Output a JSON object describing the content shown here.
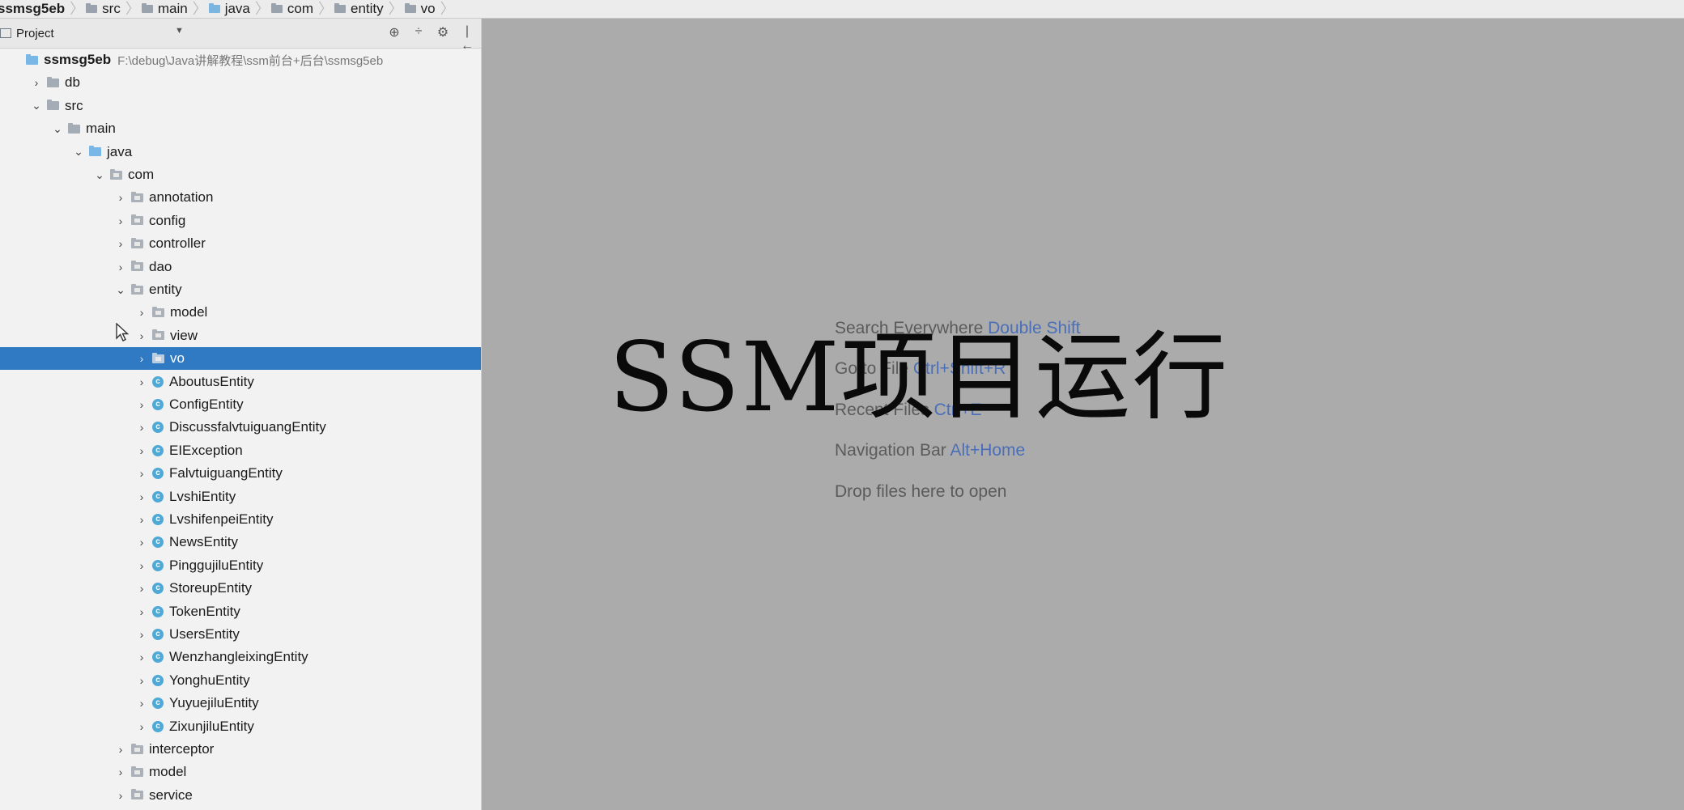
{
  "breadcrumb": [
    {
      "label": "ssmsg5eb",
      "icon": "module-folder-icon"
    },
    {
      "label": "src",
      "icon": "folder-icon"
    },
    {
      "label": "main",
      "icon": "folder-icon"
    },
    {
      "label": "java",
      "icon": "source-folder-icon"
    },
    {
      "label": "com",
      "icon": "package-icon"
    },
    {
      "label": "entity",
      "icon": "package-icon"
    },
    {
      "label": "vo",
      "icon": "package-icon"
    }
  ],
  "panel": {
    "title": "Project",
    "tools": [
      "⊕",
      "÷",
      "⚙",
      "|←"
    ]
  },
  "tree": [
    {
      "label": "ssmsg5eb",
      "note": "F:\\debug\\Java讲解教程\\ssm前台+后台\\ssmsg5eb",
      "depth": 0,
      "arrow": "",
      "icon": "module",
      "bold": true
    },
    {
      "label": "db",
      "depth": 1,
      "arrow": ">",
      "icon": "folder"
    },
    {
      "label": "src",
      "depth": 1,
      "arrow": "v",
      "icon": "folder"
    },
    {
      "label": "main",
      "depth": 2,
      "arrow": "v",
      "icon": "folder"
    },
    {
      "label": "java",
      "depth": 3,
      "arrow": "v",
      "icon": "src"
    },
    {
      "label": "com",
      "depth": 4,
      "arrow": "v",
      "icon": "pkg"
    },
    {
      "label": "annotation",
      "depth": 5,
      "arrow": ">",
      "icon": "pkg"
    },
    {
      "label": "config",
      "depth": 5,
      "arrow": ">",
      "icon": "pkg"
    },
    {
      "label": "controller",
      "depth": 5,
      "arrow": ">",
      "icon": "pkg"
    },
    {
      "label": "dao",
      "depth": 5,
      "arrow": ">",
      "icon": "pkg"
    },
    {
      "label": "entity",
      "depth": 5,
      "arrow": "v",
      "icon": "pkg"
    },
    {
      "label": "model",
      "depth": 6,
      "arrow": ">",
      "icon": "pkg"
    },
    {
      "label": "view",
      "depth": 6,
      "arrow": ">",
      "icon": "pkg"
    },
    {
      "label": "vo",
      "depth": 6,
      "arrow": ">",
      "icon": "pkg",
      "selected": true
    },
    {
      "label": "AboutusEntity",
      "depth": 6,
      "arrow": ">",
      "icon": "class"
    },
    {
      "label": "ConfigEntity",
      "depth": 6,
      "arrow": ">",
      "icon": "class"
    },
    {
      "label": "DiscussfalvtuiguangEntity",
      "depth": 6,
      "arrow": ">",
      "icon": "class"
    },
    {
      "label": "EIException",
      "depth": 6,
      "arrow": ">",
      "icon": "class"
    },
    {
      "label": "FalvtuiguangEntity",
      "depth": 6,
      "arrow": ">",
      "icon": "class"
    },
    {
      "label": "LvshiEntity",
      "depth": 6,
      "arrow": ">",
      "icon": "class"
    },
    {
      "label": "LvshifenpeiEntity",
      "depth": 6,
      "arrow": ">",
      "icon": "class"
    },
    {
      "label": "NewsEntity",
      "depth": 6,
      "arrow": ">",
      "icon": "class"
    },
    {
      "label": "PinggujiluEntity",
      "depth": 6,
      "arrow": ">",
      "icon": "class"
    },
    {
      "label": "StoreupEntity",
      "depth": 6,
      "arrow": ">",
      "icon": "class"
    },
    {
      "label": "TokenEntity",
      "depth": 6,
      "arrow": ">",
      "icon": "class"
    },
    {
      "label": "UsersEntity",
      "depth": 6,
      "arrow": ">",
      "icon": "class"
    },
    {
      "label": "WenzhangleixingEntity",
      "depth": 6,
      "arrow": ">",
      "icon": "class"
    },
    {
      "label": "YonghuEntity",
      "depth": 6,
      "arrow": ">",
      "icon": "class"
    },
    {
      "label": "YuyuejiluEntity",
      "depth": 6,
      "arrow": ">",
      "icon": "class"
    },
    {
      "label": "ZixunjiluEntity",
      "depth": 6,
      "arrow": ">",
      "icon": "class"
    },
    {
      "label": "interceptor",
      "depth": 5,
      "arrow": ">",
      "icon": "pkg"
    },
    {
      "label": "model",
      "depth": 5,
      "arrow": ">",
      "icon": "pkg"
    },
    {
      "label": "service",
      "depth": 5,
      "arrow": ">",
      "icon": "pkg"
    }
  ],
  "welcome": {
    "items": [
      {
        "text": "Search Everywhere",
        "key": "Double Shift"
      },
      {
        "text": "Go to File",
        "key": "Ctrl+Shift+R"
      },
      {
        "text": "Recent Files",
        "key": "Ctrl+E"
      },
      {
        "text": "Navigation Bar",
        "key": "Alt+Home"
      },
      {
        "text": "Drop files here to open",
        "key": ""
      }
    ]
  },
  "overlay_title": "SSM项目运行",
  "colors": {
    "selection": "#2f7ac3",
    "editor_bg": "#ababab",
    "shortcut": "#4a6fb8"
  }
}
